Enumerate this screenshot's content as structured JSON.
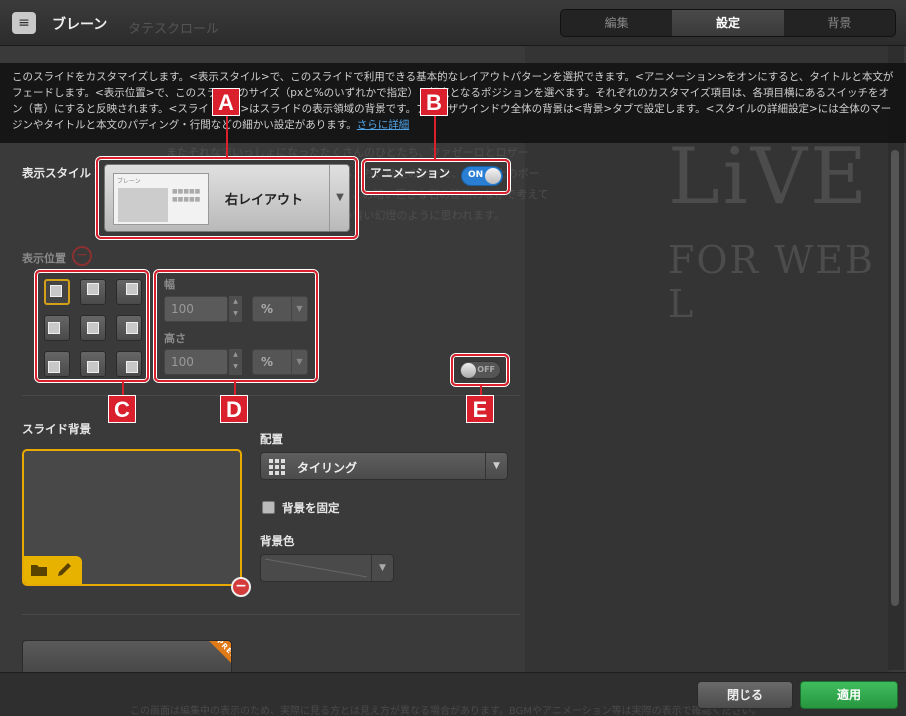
{
  "header": {
    "title": "ブレーン",
    "bg_label": "タテスクロール",
    "tabs": [
      "編集",
      "設定",
      "背景"
    ],
    "active_tab": "設定"
  },
  "description": {
    "text": "このスライドをカスタマイズします。<表示スタイル>で、このスライドで利用できる基本的なレイアウトパターンを選択できます。<アニメーション>をオンにすると、タイトルと本文がフェードします。<表示位置>で、このスライドのサイズ（pxと%のいずれかで指定）と起点となるポジションを選べます。それぞれのカスタマイズ項目は、各項目横にあるスイッチをオン（青）にすると反映されます。<スライド背景>はスライドの表示領域の背景です。ブラウザウインドウ全体の背景は<背景>タブで設定します。<スタイルの詳細設定>には全体のマージンやタイトルと本文のパディング・行間などの細かい設定があります。",
    "link": "さらに詳細"
  },
  "background_preview": {
    "headline": "LiVE",
    "subheadline": "FOR WEB L",
    "body_lines": [
      "またそれなでいっしょになったたくさんのひとたち、ファゼーロとロザー",
      "ロ、羊飼のミーロや、顔の赤いこどもたち、地主のテーモ、山猫博士のボー",
      "ガンノー、などの姿が見えます。いまこの暗い巨きな石の建物のなかで考えて",
      "いると、みんなむかし風のなつかしい青い幻燈のように思われます。"
    ]
  },
  "display_style": {
    "label": "表示スタイル",
    "thumbnail_header": "ブレーン",
    "selected": "右レイアウト"
  },
  "animation": {
    "label": "アニメーション",
    "state": "ON"
  },
  "display_position": {
    "label": "表示位置",
    "selected_cell": 0,
    "width_label": "幅",
    "width_value": "100",
    "width_unit": "%",
    "height_label": "高さ",
    "height_value": "100",
    "height_unit": "%",
    "toggle_state": "OFF"
  },
  "slide_background": {
    "label": "スライド背景",
    "placement_label": "配置",
    "placement_value": "タイリング",
    "fix_label": "背景を固定",
    "fix_checked": false,
    "color_label": "背景色"
  },
  "premium_badge": "PREMIUM",
  "footer": {
    "note": "この画面は編集中の表示のため、実際に見る方とは見え方が異なる場合があります。BGMやアニメーション等は実際の表示で確認ください。",
    "close_label": "閉じる",
    "apply_label": "適用"
  },
  "callouts": [
    "A",
    "B",
    "C",
    "D",
    "E"
  ],
  "colors": {
    "callout_red": "#d9202c",
    "toggle_blue": "#2a7fd4",
    "apply_green": "#2fa84b",
    "accent_yellow": "#e8a900"
  }
}
